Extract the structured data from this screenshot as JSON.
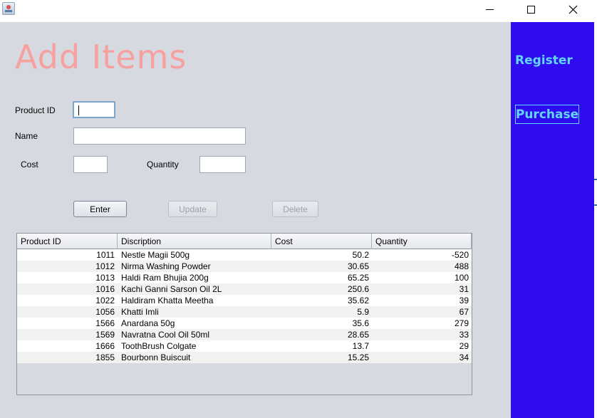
{
  "window": {
    "icon": "java-cup-icon",
    "controls": [
      "minimize-icon",
      "maximize-icon",
      "close-icon"
    ]
  },
  "form": {
    "title": "Add Items",
    "product_id_label": "Product ID",
    "product_id_value": "",
    "name_label": "Name",
    "name_value": "",
    "cost_label": "Cost",
    "cost_value": "",
    "quantity_label": "Quantity",
    "quantity_value": ""
  },
  "buttons": {
    "enter": "Enter",
    "update": "Update",
    "delete": "Delete"
  },
  "table": {
    "columns": [
      "Product ID",
      "Discription",
      "Cost",
      "Quantity"
    ],
    "rows": [
      [
        "1011",
        "Nestle Magii 500g",
        "50.2",
        "-520"
      ],
      [
        "1012",
        "Nirma Washing Powder",
        "30.65",
        "488"
      ],
      [
        "1013",
        "Haldi Ram Bhujia 200g",
        "65.25",
        "100"
      ],
      [
        "1016",
        "Kachi Ganni Sarson Oil 2L",
        "250.6",
        "31"
      ],
      [
        "1022",
        "Haldiram Khatta Meetha",
        "35.62",
        "39"
      ],
      [
        "1056",
        "Khatti Imli",
        "5.9",
        "67"
      ],
      [
        "1566",
        "Anardana 50g",
        "35.6",
        "279"
      ],
      [
        "1569",
        "Navratna Cool Oil 50ml",
        "28.65",
        "33"
      ],
      [
        "1666",
        "ToothBrush Colgate",
        "13.7",
        "29"
      ],
      [
        "1855",
        "Bourbonn Buiscuit",
        "15.25",
        "34"
      ]
    ]
  },
  "side": {
    "register": "Register",
    "purchase": "Purchase"
  },
  "colors": {
    "title": "#f6a0a0",
    "panel_bg": "#d6d9e0",
    "side_bg": "#2f0bf0",
    "side_text": "#63d6f7"
  }
}
